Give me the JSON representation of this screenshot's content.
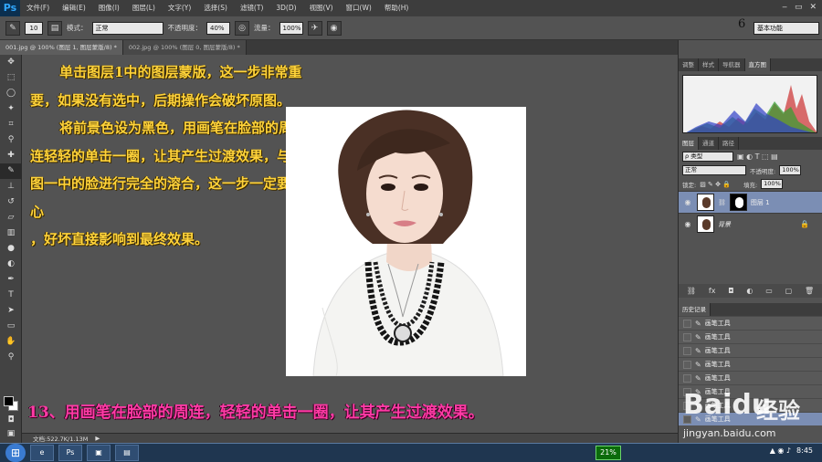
{
  "app": {
    "logo": "Ps"
  },
  "menu": [
    "文件(F)",
    "编辑(E)",
    "图像(I)",
    "图层(L)",
    "文字(Y)",
    "选择(S)",
    "滤镜(T)",
    "3D(D)",
    "视图(V)",
    "窗口(W)",
    "帮助(H)"
  ],
  "options": {
    "brush_size": "10",
    "mode_label": "模式：",
    "mode_value": "正常",
    "opacity_label": "不透明度：",
    "opacity_value": "40%",
    "flow_label": "流量：",
    "flow_value": "100%"
  },
  "workspace": {
    "number": "6",
    "name": "基本功能"
  },
  "tabs": [
    "001.jpg @ 100% (图层 1, 图层蒙版/8) *",
    "002.jpg @ 100% (图层 0, 图层蒙版/8) *"
  ],
  "instructions": {
    "para1": "单击图层1中的图层蒙版，这一步非常重要，如果没有选中，后期操作会破坏原图。",
    "para2": "将前景色设为黑色，用画笔在脸部的周连轻轻的单击一圈，让其产生过渡效果，与原图一中的脸进行完全的溶合，这一步一定要细心",
    "para3": "，好坏直接影响到最终效果。"
  },
  "step_caption": "13、用画笔在脸部的周连，轻轻的单击一圈，让其产生过渡效果。",
  "status": {
    "doc_info": "文档:522.7K/1.13M"
  },
  "panels": {
    "top_tabs": [
      "调整",
      "样式",
      "导航器",
      "直方图"
    ],
    "layer_tabs": [
      "图层",
      "通道",
      "路径"
    ],
    "kind_filter": "ρ 类型",
    "blend_mode": "正常",
    "opacity_label": "不透明度:",
    "opacity_value": "100%",
    "lock_label": "锁定:",
    "fill_label": "填充:",
    "fill_value": "100%",
    "layers": [
      {
        "name": "图层 1"
      },
      {
        "name": "背景"
      }
    ],
    "history_title": "历史记录",
    "history_items": [
      "画笔工具",
      "画笔工具",
      "画笔工具",
      "画笔工具",
      "画笔工具",
      "画笔工具",
      "画笔工具",
      "画笔工具"
    ]
  },
  "taskbar": {
    "cpu": "21%",
    "time": "8:45"
  },
  "watermark": {
    "brand": "Baidu",
    "word": "经验",
    "url": "jingyan.baidu.com"
  },
  "colors": {
    "instruction_text": "#ffd33a",
    "caption_text": "#ff3aa5",
    "selection": "#7b8eb4"
  }
}
